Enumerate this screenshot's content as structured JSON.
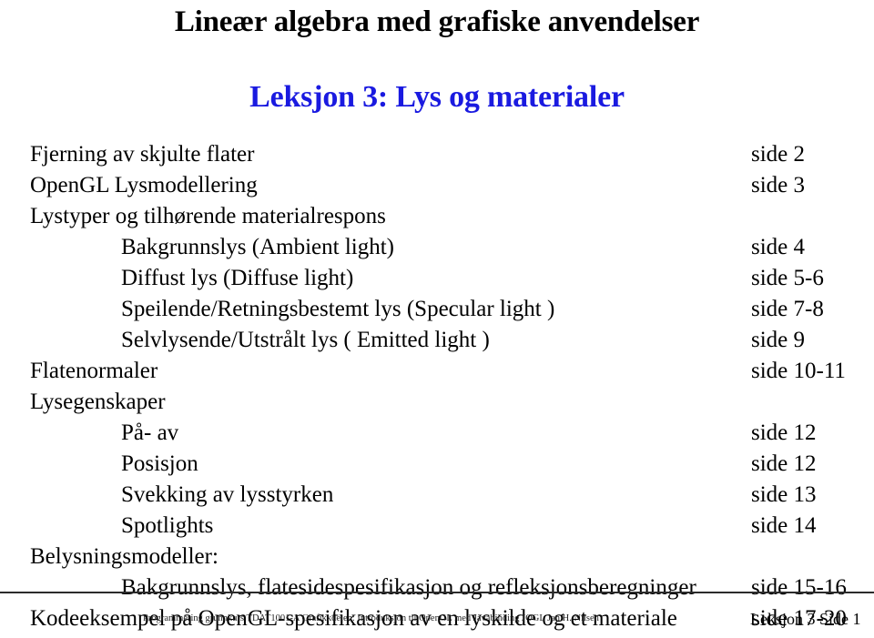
{
  "slide": {
    "title": "Lineær algebra med grafiske anvendelser",
    "subtitle": "Leksjon 3: Lys og materialer",
    "title_color": "#000000",
    "subtitle_color": "#1a1ae0",
    "background_color": "#ffffff"
  },
  "toc": {
    "rows": [
      {
        "label": "Fjerning av skjulte flater",
        "page": "side 2",
        "level": 0
      },
      {
        "label": "OpenGL Lysmodellering",
        "page": "side 3",
        "level": 0
      },
      {
        "label": "Lystyper og tilhørende materialrespons",
        "page": "",
        "level": 0
      },
      {
        "label": "Bakgrunnslys (Ambient light)",
        "page": "side 4",
        "level": 1
      },
      {
        "label": "Diffust lys (Diffuse light)",
        "page": "side 5-6",
        "level": 1
      },
      {
        "label": "Speilende/Retningsbestemt lys (Specular light )",
        "page": "side 7-8",
        "level": 1
      },
      {
        "label": "Selvlysende/Utstrålt lys ( Emitted light )",
        "page": "side 9",
        "level": 1
      },
      {
        "label": "Flatenormaler",
        "page": "side 10-11",
        "level": 0
      },
      {
        "label": "Lysegenskaper",
        "page": "",
        "level": 0
      },
      {
        "label": "På- av",
        "page": "side 12",
        "level": 1
      },
      {
        "label": "Posisjon",
        "page": "side 12",
        "level": 1
      },
      {
        "label": "Svekking av lysstyrken",
        "page": "side 13",
        "level": 1
      },
      {
        "label": "Spotlights",
        "page": "side 14",
        "level": 1
      },
      {
        "label": "Belysningsmodeller:",
        "page": "",
        "level": 0
      },
      {
        "label": "Bakgrunnslys, flatesidespesifikasjon og refleksjonsberegninger",
        "page": "side 15-16",
        "level": 1
      },
      {
        "label": "Kodeeksempel på OpenGL-spesifikasjon av en lyskilde og et materiale",
        "page": "side 17-20",
        "level": 0
      }
    ]
  },
  "footer": {
    "note": "Programmering grunnkurs TDAT1001-A Grafikkdelen: Introduksjon til OpenGL med Javabinding JOGL Jan H. Nilsen",
    "page_label": "Leksjon 3 Side 1",
    "rule_color": "#2b2b2b"
  }
}
